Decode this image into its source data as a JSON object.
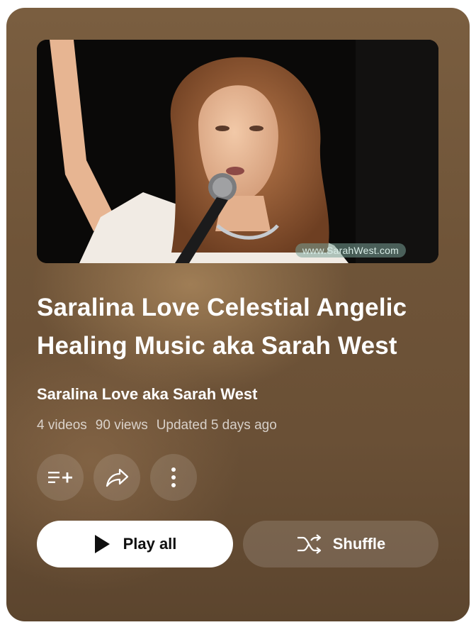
{
  "thumbnail": {
    "alt": "Saralina Love singing into a microphone",
    "watermark": "www.SarahWest.com"
  },
  "playlist": {
    "title": "Saralina Love Celestial Angelic Healing Music aka Sarah West",
    "owner": "Saralina Love aka Sarah West",
    "video_count": "4 videos",
    "views": "90 views",
    "updated": "Updated 5 days ago"
  },
  "actions": {
    "save_icon": "playlist-add-icon",
    "share_icon": "share-icon",
    "more_icon": "more-vert-icon"
  },
  "buttons": {
    "play_all": "Play all",
    "shuffle": "Shuffle"
  },
  "colors": {
    "card_bg": "#6f5438",
    "play_bg": "#ffffff",
    "text_primary": "#ffffff"
  }
}
